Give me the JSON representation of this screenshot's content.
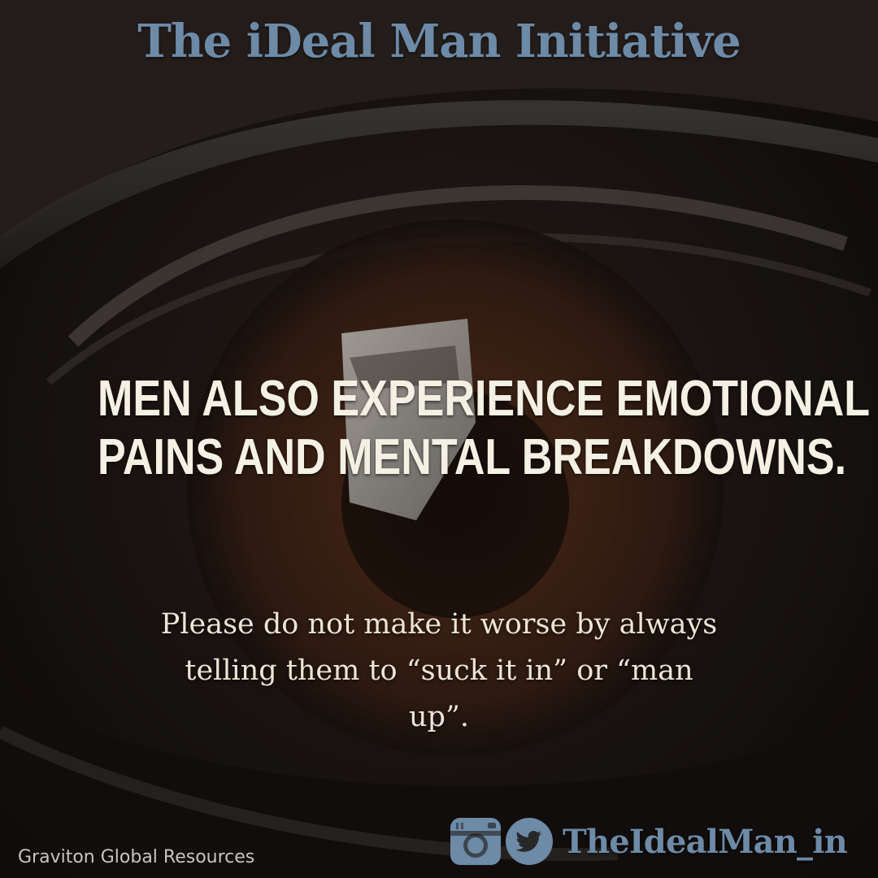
{
  "header": {
    "title": "The iDeal Man Initiative"
  },
  "main": {
    "headline_lines": [
      "MEN ALSO EXPERIENCE EMOTIONAL",
      "PAINS AND MENTAL BREAKDOWNS."
    ],
    "body_lines": [
      "Please do not make it worse by always",
      "telling them to “suck it in” or “man",
      "up”."
    ]
  },
  "footer": {
    "credit": "Graviton Global Resources",
    "social_icons": [
      "instagram-icon",
      "twitter-icon"
    ],
    "handle": "TheIdealMan_in"
  },
  "colors": {
    "title": "#6d8aa6",
    "headline": "#f4f1e4",
    "body": "#ece5d5",
    "background": "#1c1613"
  }
}
